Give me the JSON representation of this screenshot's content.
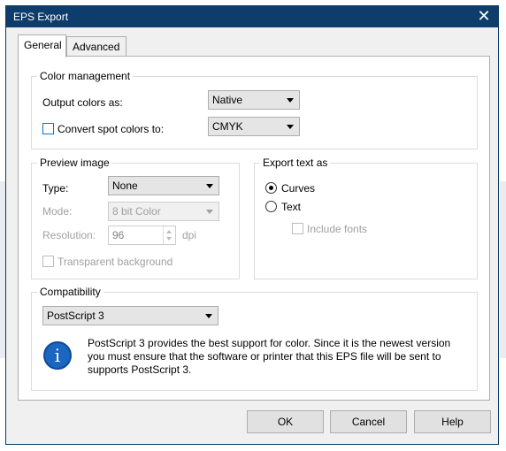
{
  "window": {
    "title": "EPS Export"
  },
  "tabs": [
    {
      "label": "General"
    },
    {
      "label": "Advanced"
    }
  ],
  "color_management": {
    "legend": "Color management",
    "output_label": "Output colors as:",
    "output_value": "Native",
    "spot_label": "Convert spot colors to:",
    "spot_value": "CMYK"
  },
  "preview": {
    "legend": "Preview image",
    "type_label": "Type:",
    "type_value": "None",
    "mode_label": "Mode:",
    "mode_value": "8 bit Color",
    "resolution_label": "Resolution:",
    "resolution_value": "96",
    "resolution_unit": "dpi",
    "transparent_label": "Transparent background"
  },
  "export_text": {
    "legend": "Export text as",
    "curves_label": "Curves",
    "text_label": "Text",
    "include_fonts_label": "Include fonts"
  },
  "compatibility": {
    "legend": "Compatibility",
    "value": "PostScript 3",
    "info": "PostScript 3 provides the best support for color. Since it is the newest version you must ensure that the software or printer that this EPS file will be sent to supports PostScript 3."
  },
  "buttons": {
    "ok": "OK",
    "cancel": "Cancel",
    "help": "Help"
  },
  "colors": {
    "titlebar": "#0f3d6b",
    "info_icon": "#1a66c1",
    "checkbox_accent": "#0078d7"
  }
}
